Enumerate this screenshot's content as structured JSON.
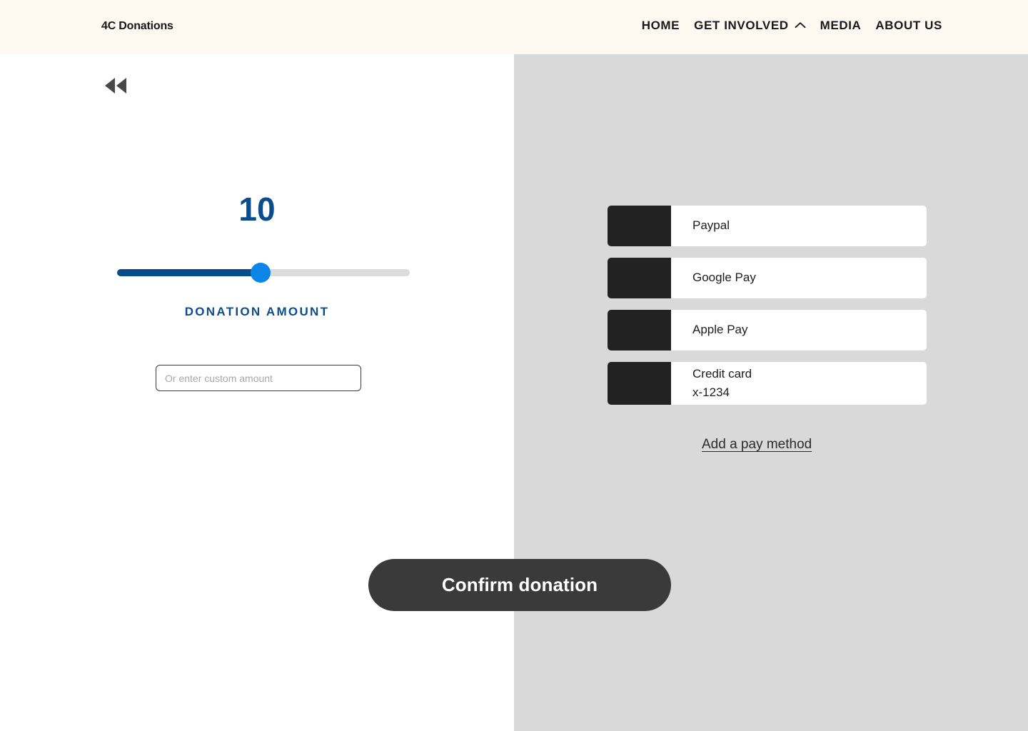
{
  "header": {
    "brand": "4C Donations",
    "nav": [
      {
        "label": "HOME",
        "has_chevron": false
      },
      {
        "label": "GET INVOLVED",
        "has_chevron": true
      },
      {
        "label": "MEDIA",
        "has_chevron": false
      },
      {
        "label": "ABOUT US",
        "has_chevron": false
      }
    ],
    "background_color": "#fdf8f0"
  },
  "back": {
    "icon": "rewind-double-left-icon"
  },
  "donation": {
    "amount_value": "10",
    "amount_label": "DONATION AMOUNT",
    "slider": {
      "value": 10,
      "min": 0,
      "max": 100,
      "percent": 49,
      "fill_color": "#0a4b8c",
      "track_color": "#dcdcdc",
      "thumb_color": "#0c85e8"
    },
    "custom_input": {
      "placeholder": "Or enter custom amount",
      "value": ""
    },
    "accent_color": "#0d4c8c"
  },
  "payment": {
    "methods": [
      {
        "name": "Paypal",
        "sub": "",
        "logo": "paypal-logo-placeholder"
      },
      {
        "name": "Google Pay",
        "sub": "",
        "logo": "google-pay-logo-placeholder"
      },
      {
        "name": "Apple Pay",
        "sub": "",
        "logo": "apple-pay-logo-placeholder"
      },
      {
        "name": "Credit card",
        "sub": "x-1234",
        "logo": "credit-card-logo-placeholder"
      }
    ],
    "add_method_label": "Add a pay method",
    "panel_color": "#d9d9d9"
  },
  "actions": {
    "confirm_label": "Confirm donation",
    "confirm_color": "#3a3a3a"
  }
}
